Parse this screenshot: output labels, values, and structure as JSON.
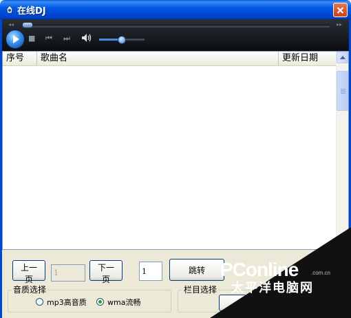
{
  "window": {
    "title": "在线DJ"
  },
  "player": {
    "seek_position": 0.01,
    "volume": 0.5
  },
  "playlist": {
    "columns": [
      "序号",
      "歌曲名",
      "更新日期"
    ],
    "rows": []
  },
  "paging": {
    "prev_label": "上一页",
    "current_page": "1",
    "next_label": "下一页",
    "jump_page": "1",
    "jump_label": "跳转"
  },
  "quality": {
    "title": "音质选择",
    "options": [
      "mp3高音质",
      "wma流畅"
    ],
    "selected": "wma流畅"
  },
  "category": {
    "title": "栏目选择"
  },
  "watermark": {
    "brand": "PConline",
    "domain": ".com.cn",
    "chinese": "太平洋电脑网"
  }
}
